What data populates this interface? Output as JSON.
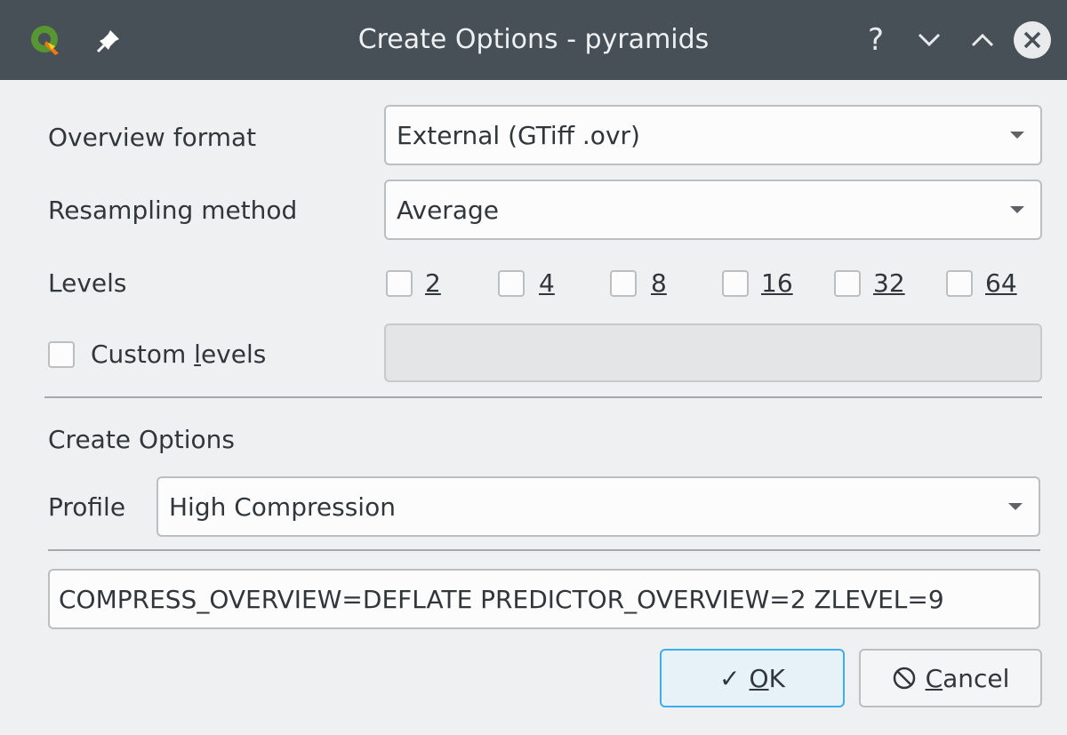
{
  "window": {
    "title": "Create Options - pyramids",
    "help_glyph": "?",
    "minimize_glyph": "⌄",
    "maximize_glyph": "⌃",
    "close_glyph": "✕"
  },
  "overview_format": {
    "label": "Overview format",
    "value": "External (GTiff .ovr)"
  },
  "resampling_method": {
    "label": "Resampling method",
    "value": "Average"
  },
  "levels": {
    "label": "Levels",
    "options": [
      {
        "value": "2",
        "checked": false
      },
      {
        "value": "4",
        "checked": false
      },
      {
        "value": "8",
        "checked": false
      },
      {
        "value": "16",
        "checked": false
      },
      {
        "value": "32",
        "checked": false
      },
      {
        "value": "64",
        "checked": false
      }
    ]
  },
  "custom_levels": {
    "label_pre": "Custom ",
    "label_mnemonic": "l",
    "label_post": "evels",
    "checked": false,
    "value": ""
  },
  "create_options": {
    "heading": "Create Options",
    "profile_label": "Profile",
    "profile_value": "High Compression",
    "options_text": "COMPRESS_OVERVIEW=DEFLATE PREDICTOR_OVERVIEW=2 ZLEVEL=9"
  },
  "buttons": {
    "ok": {
      "glyph": "✓",
      "mnemonic": "O",
      "rest": "K"
    },
    "cancel": {
      "glyph": "⃠",
      "mnemonic": "C",
      "rest": "ancel"
    }
  },
  "colors": {
    "titlebar": "#475057",
    "background": "#eff0f1",
    "focus": "#3daee9",
    "logo_green": "#589632",
    "logo_yellow": "#ee7913"
  },
  "icons": {
    "logo": "qgis-logo",
    "pin": "pin-icon",
    "help": "help-icon",
    "minimize": "chevron-down-icon",
    "maximize": "chevron-up-icon",
    "close": "close-icon",
    "ok": "checkmark-icon",
    "cancel": "cancel-icon"
  }
}
